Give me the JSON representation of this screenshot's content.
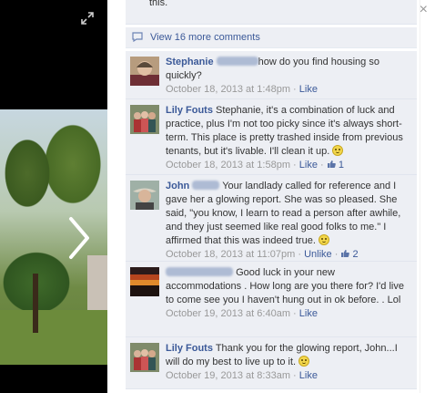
{
  "header": {
    "cut_text": "this."
  },
  "view_more": {
    "label": "View 16 more comments"
  },
  "comments": [
    {
      "name": "Stephanie",
      "text": "how do you find housing so quickly?",
      "date": "October 18, 2013 at 1:48pm",
      "sep": "·",
      "like_label": "Like"
    },
    {
      "name": "Lily Fouts",
      "text": "Stephanie, it's a combination of luck and practice, plus I'm not too picky since it's always short-term. This place is pretty trashed inside from previous tenants, but it's livable. I'll clean it up.",
      "date": "October 18, 2013 at 1:58pm",
      "sep": "·",
      "like_label": "Like",
      "like_count": "1"
    },
    {
      "name": "John",
      "text": "Your landlady called for reference and I gave her a glowing report. She was so pleased. She said, \"you know, I learn to read a person after awhile, and they just seemed like real good folks to me.\" I affirmed that this was indeed true.",
      "date": "October 18, 2013 at 11:07pm",
      "sep": "·",
      "like_label": "Unlike",
      "like_count": "2"
    },
    {
      "name": "",
      "text": "Good luck in your new accommodations . How long are you there for? I'd live to come see you I haven't hung out in ok before. . Lol",
      "date": "October 19, 2013 at 6:40am",
      "sep": "·",
      "like_label": "Like"
    },
    {
      "name": "Lily Fouts",
      "text": "Thank you for the glowing report, John...I will do my best to live up to it.",
      "date": "October 19, 2013 at 8:33am",
      "sep": "·",
      "like_label": "Like"
    }
  ],
  "icons": {
    "expand": "expand-icon",
    "close": "close-icon",
    "next": "next-arrow-icon",
    "comment": "comment-icon",
    "like": "thumbs-up-icon",
    "smiley": "smiley-icon"
  },
  "colors": {
    "link": "#3b5998",
    "panel_bg": "#edeff4",
    "meta": "#999999"
  }
}
